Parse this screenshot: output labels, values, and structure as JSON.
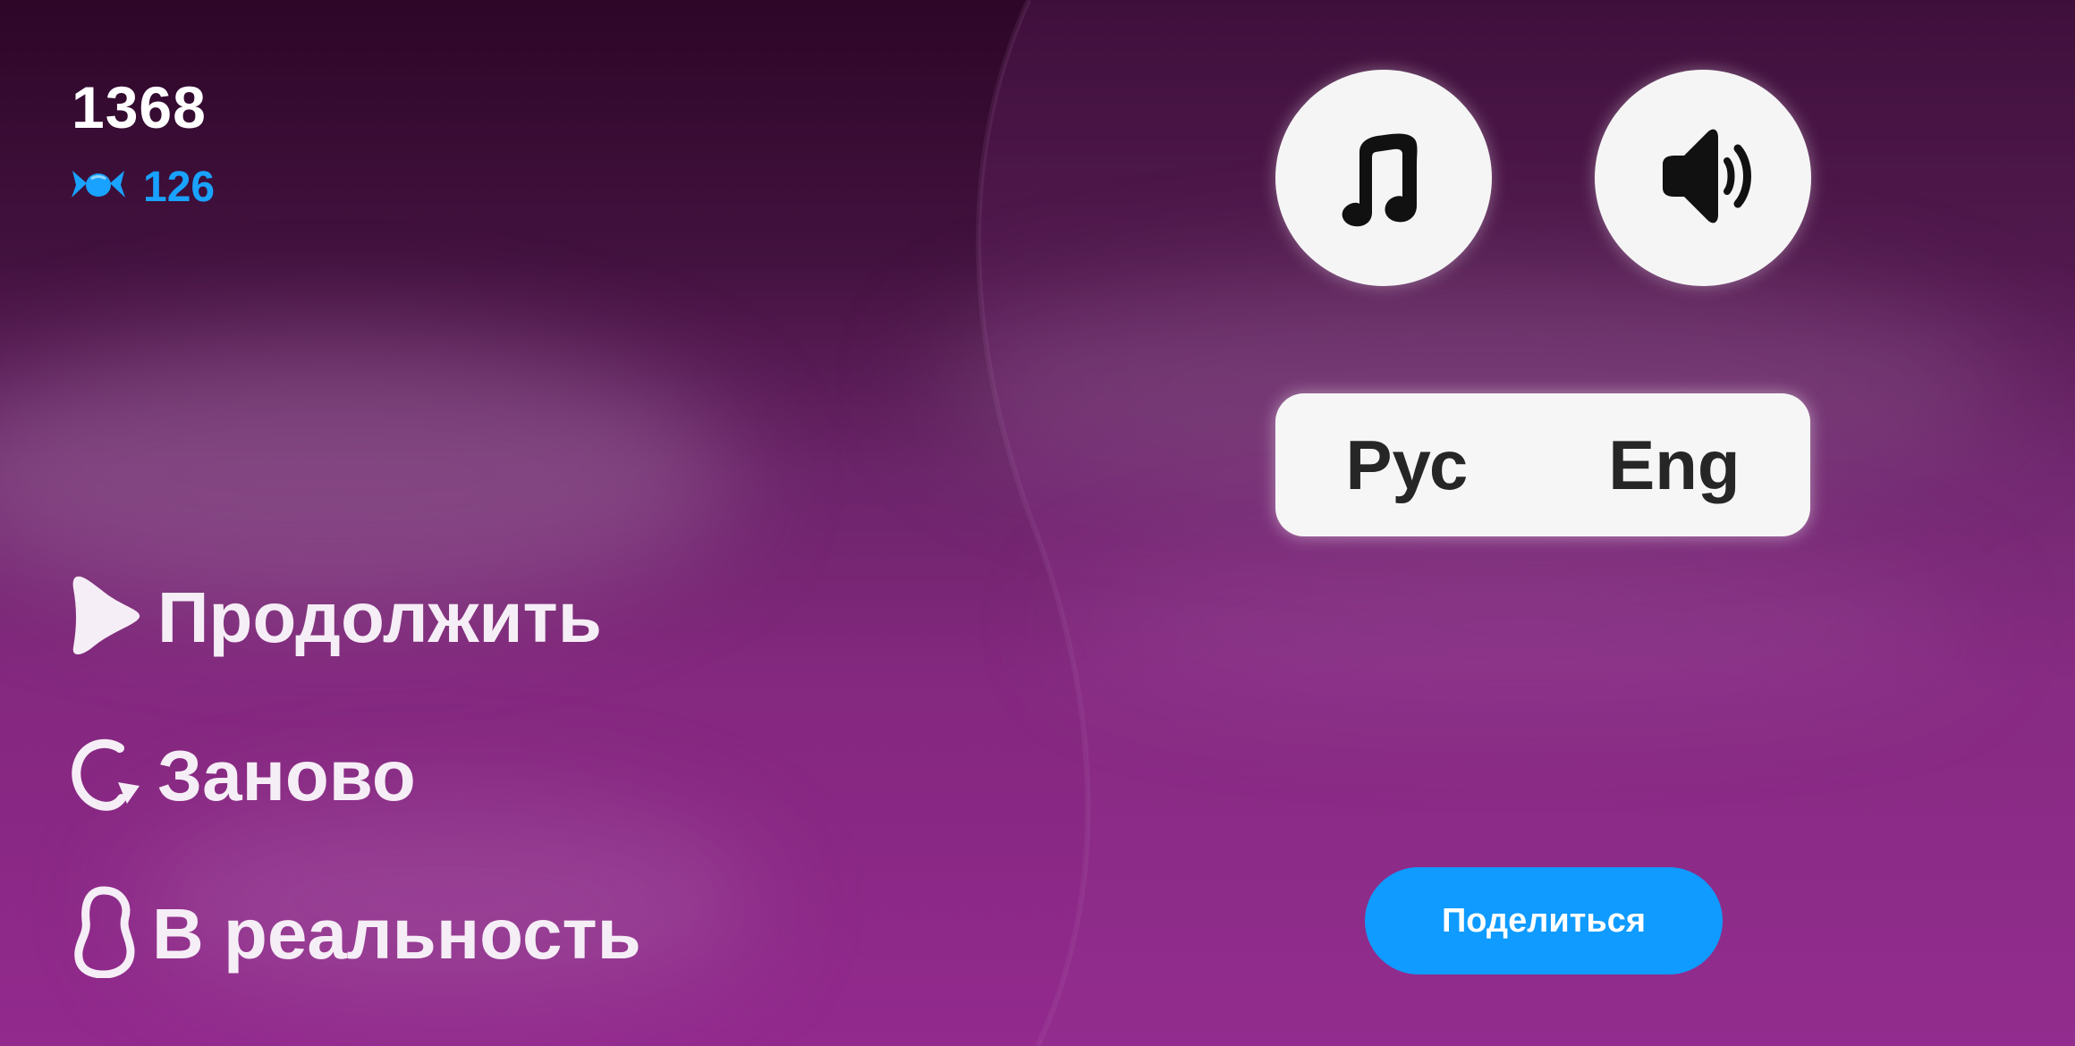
{
  "hud": {
    "score": "1368",
    "candies": "126",
    "candy_icon": "candy-icon"
  },
  "menu": {
    "continue_label": "Продолжить",
    "restart_label": "Заново",
    "reality_label": "В реальность"
  },
  "audio": {
    "music_icon": "music-note-icon",
    "sound_icon": "speaker-icon"
  },
  "language": {
    "options": [
      "Рус",
      "Eng"
    ]
  },
  "share": {
    "label": "Поделиться"
  },
  "colors": {
    "accent": "#0f9bff",
    "candy_text": "#19a2ff",
    "background_top": "#2d0628",
    "background_bottom": "#92298d"
  }
}
